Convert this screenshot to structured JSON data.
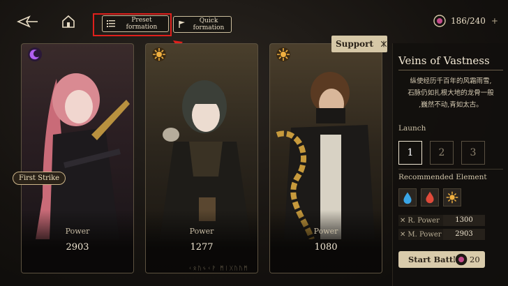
{
  "topbar": {
    "preset_label_line1": "Preset",
    "preset_label_line2": "formation",
    "quick_label_line1": "Quick",
    "quick_label_line2": "formation",
    "stamina": "186/240",
    "stamina_plus": "+"
  },
  "cards": [
    {
      "power_label": "Power",
      "power": "2903",
      "tag": "First Strike",
      "element_color": "#9b4bd6"
    },
    {
      "power_label": "Power",
      "power": "1277",
      "element_color": "#e0a23a"
    },
    {
      "power_label": "Power",
      "power": "1080",
      "element_color": "#e0a23a"
    }
  ],
  "support_label": "Support",
  "runes": "ᚲᛟᚢᛃᚲᚹ ᛗᛁᚷᚢᚢᛗ",
  "panel": {
    "title": "Veins of Vastness",
    "description": [
      "纵使经历千百年的风霜雨雪,",
      "石脉仍如扎根大地的龙骨一般",
      ",巍然不动,青如太古。"
    ],
    "launch_label": "Launch",
    "launch_options": [
      "1",
      "2",
      "3"
    ],
    "recommended_label": "Recommended Element",
    "r_power_label": "R. Power",
    "r_power": "1300",
    "m_power_label": "M. Power",
    "m_power": "2903",
    "start_label": "Start Battle",
    "start_cost": "20"
  },
  "colors": {
    "highlight": "#e0201c",
    "accent": "#d9cbab"
  }
}
